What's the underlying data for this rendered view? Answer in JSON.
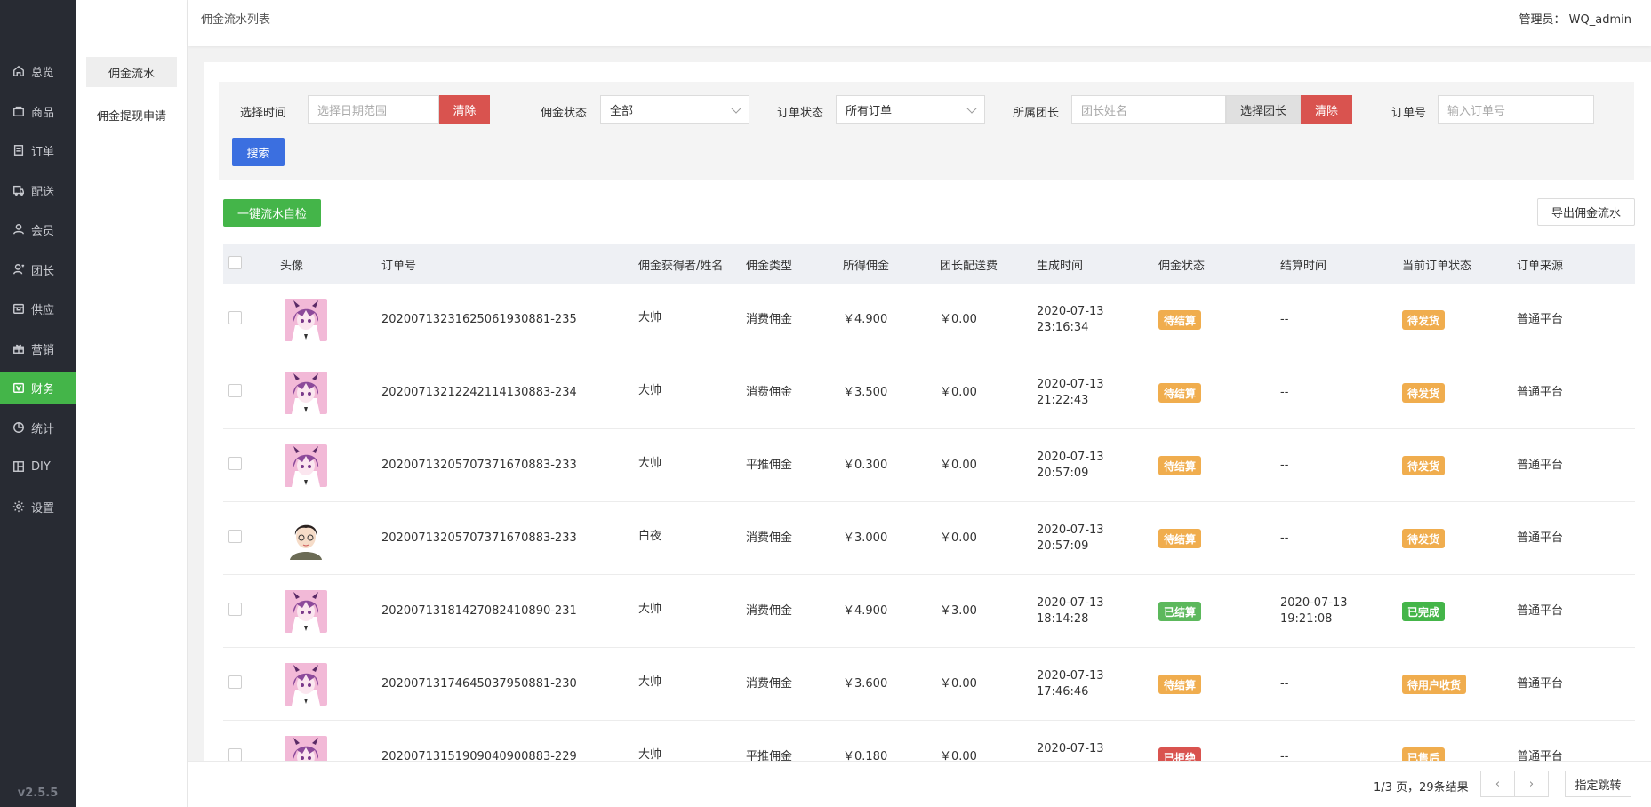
{
  "sidebar": {
    "items": [
      {
        "label": "总览",
        "icon": "home-icon"
      },
      {
        "label": "商品",
        "icon": "goods-icon"
      },
      {
        "label": "订单",
        "icon": "order-icon"
      },
      {
        "label": "配送",
        "icon": "delivery-icon"
      },
      {
        "label": "会员",
        "icon": "member-icon"
      },
      {
        "label": "团长",
        "icon": "leader-icon"
      },
      {
        "label": "供应",
        "icon": "supply-icon"
      },
      {
        "label": "营销",
        "icon": "gift-icon"
      },
      {
        "label": "财务",
        "icon": "finance-icon"
      },
      {
        "label": "统计",
        "icon": "stats-icon"
      },
      {
        "label": "DIY",
        "icon": "diy-icon"
      },
      {
        "label": "设置",
        "icon": "gear-icon"
      }
    ],
    "active_index": 8,
    "version": "v2.5.5"
  },
  "subnav": {
    "items": [
      {
        "label": "佣金流水"
      },
      {
        "label": "佣金提现申请"
      }
    ],
    "active_index": 0
  },
  "header": {
    "breadcrumb": "佣金流水列表",
    "admin": "管理员： WQ_admin"
  },
  "filter": {
    "time_label": "选择时间",
    "time_placeholder": "选择日期范围",
    "clear_label": "清除",
    "commission_status_label": "佣金状态",
    "commission_status_value": "全部",
    "order_status_label": "订单状态",
    "order_status_value": "所有订单",
    "leader_label": "所属团长",
    "leader_placeholder": "团长姓名",
    "select_leader_label": "选择团长",
    "clear2_label": "清除",
    "order_no_label": "订单号",
    "order_no_placeholder": "输入订单号",
    "search_label": "搜索"
  },
  "actions": {
    "self_check_label": "一键流水自检",
    "export_label": "导出佣金流水"
  },
  "table": {
    "headers": [
      "头像",
      "订单号",
      "佣金获得者/姓名",
      "佣金类型",
      "所得佣金",
      "团长配送费",
      "生成时间",
      "佣金状态",
      "结算时间",
      "当前订单状态",
      "订单来源"
    ],
    "rows": [
      {
        "avatar": "anime",
        "order_no": "20200713231625061930881-235",
        "name": "大帅",
        "type": "消费佣金",
        "amount": "￥4.900",
        "fee": "￥0.00",
        "date": "2020-07-13",
        "time": "23:16:34",
        "status": "待结算",
        "status_color": "#f0ad4e",
        "settle_date": "--",
        "settle_time": "",
        "order_status": "待发货",
        "order_status_color": "#f0ad4e",
        "source": "普通平台"
      },
      {
        "avatar": "anime",
        "order_no": "20200713212242114130883-234",
        "name": "大帅",
        "type": "消费佣金",
        "amount": "￥3.500",
        "fee": "￥0.00",
        "date": "2020-07-13",
        "time": "21:22:43",
        "status": "待结算",
        "status_color": "#f0ad4e",
        "settle_date": "--",
        "settle_time": "",
        "order_status": "待发货",
        "order_status_color": "#f0ad4e",
        "source": "普通平台"
      },
      {
        "avatar": "anime",
        "order_no": "20200713205707371670883-233",
        "name": "大帅",
        "type": "平推佣金",
        "amount": "￥0.300",
        "fee": "￥0.00",
        "date": "2020-07-13",
        "time": "20:57:09",
        "status": "待结算",
        "status_color": "#f0ad4e",
        "settle_date": "--",
        "settle_time": "",
        "order_status": "待发货",
        "order_status_color": "#f0ad4e",
        "source": "普通平台"
      },
      {
        "avatar": "boy",
        "order_no": "20200713205707371670883-233",
        "name": "白夜",
        "type": "消费佣金",
        "amount": "￥3.000",
        "fee": "￥0.00",
        "date": "2020-07-13",
        "time": "20:57:09",
        "status": "待结算",
        "status_color": "#f0ad4e",
        "settle_date": "--",
        "settle_time": "",
        "order_status": "待发货",
        "order_status_color": "#f0ad4e",
        "source": "普通平台"
      },
      {
        "avatar": "anime",
        "order_no": "20200713181427082410890-231",
        "name": "大帅",
        "type": "消费佣金",
        "amount": "￥4.900",
        "fee": "￥3.00",
        "date": "2020-07-13",
        "time": "18:14:28",
        "status": "已结算",
        "status_color": "#5cb85c",
        "settle_date": "2020-07-13",
        "settle_time": "19:21:08",
        "order_status": "已完成",
        "order_status_color": "#44b549",
        "source": "普通平台"
      },
      {
        "avatar": "anime",
        "order_no": "20200713174645037950881-230",
        "name": "大帅",
        "type": "消费佣金",
        "amount": "￥3.600",
        "fee": "￥0.00",
        "date": "2020-07-13",
        "time": "17:46:46",
        "status": "待结算",
        "status_color": "#f0ad4e",
        "settle_date": "--",
        "settle_time": "",
        "order_status": "待用户收货",
        "order_status_color": "#f0ad4e",
        "source": "普通平台"
      },
      {
        "avatar": "anime",
        "order_no": "20200713151909040900883-229",
        "name": "大帅",
        "type": "平推佣金",
        "amount": "￥0.180",
        "fee": "￥0.00",
        "date": "2020-07-13",
        "time": "",
        "status": "已拒绝",
        "status_color": "#d9534f",
        "settle_date": "--",
        "settle_time": "",
        "order_status": "已售后",
        "order_status_color": "#f0ad4e",
        "source": "普通平台"
      }
    ]
  },
  "pagination": {
    "info": "1/3 页，29条结果",
    "prev_icon": "chevron-left-icon",
    "next_icon": "chevron-right-icon",
    "jump_label": "指定跳转"
  }
}
